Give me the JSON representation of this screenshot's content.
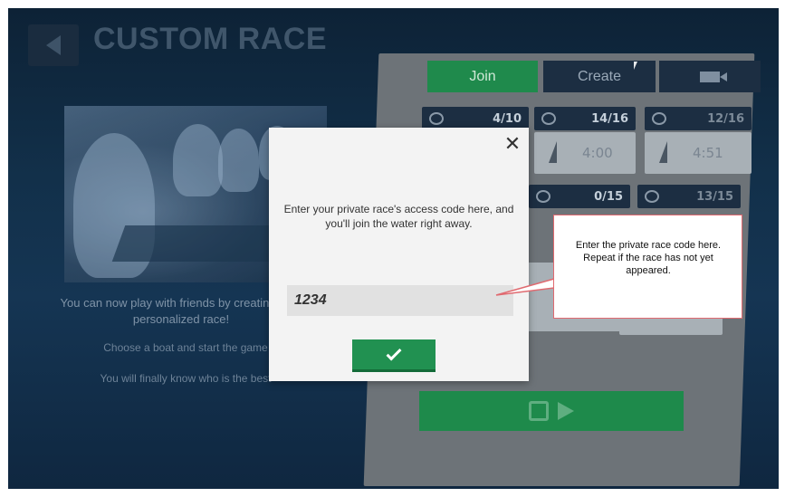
{
  "header": {
    "title": "CUSTOM RACE"
  },
  "left_panel": {
    "line1": "You can now play with friends by creating your personalized race!",
    "line2": "Choose a boat and start the game",
    "line3": "You will finally know who is the best"
  },
  "tabs": {
    "join": "Join",
    "create": "Create"
  },
  "race_cards": [
    {
      "players": "4/10"
    },
    {
      "players": "14/16",
      "time": "4:00"
    },
    {
      "players": "12/16",
      "time": "4:51"
    },
    {
      "players": "0/15"
    },
    {
      "players": "13/15"
    }
  ],
  "modal": {
    "message": "Enter your private race's access code here, and you'll join the water right away.",
    "code_value": "1234",
    "close_label": "✕"
  },
  "callout": {
    "text": "Enter the private race code here. Repeat if the race has not yet appeared."
  },
  "colors": {
    "accent_green": "#219151",
    "background_dark": "#12304a",
    "callout_border": "#e06a70"
  },
  "icons": [
    "back-arrow-icon",
    "video-camera-icon",
    "boat-icon",
    "sail-icon",
    "lock-icon",
    "play-icon",
    "close-icon",
    "checkmark-icon"
  ]
}
